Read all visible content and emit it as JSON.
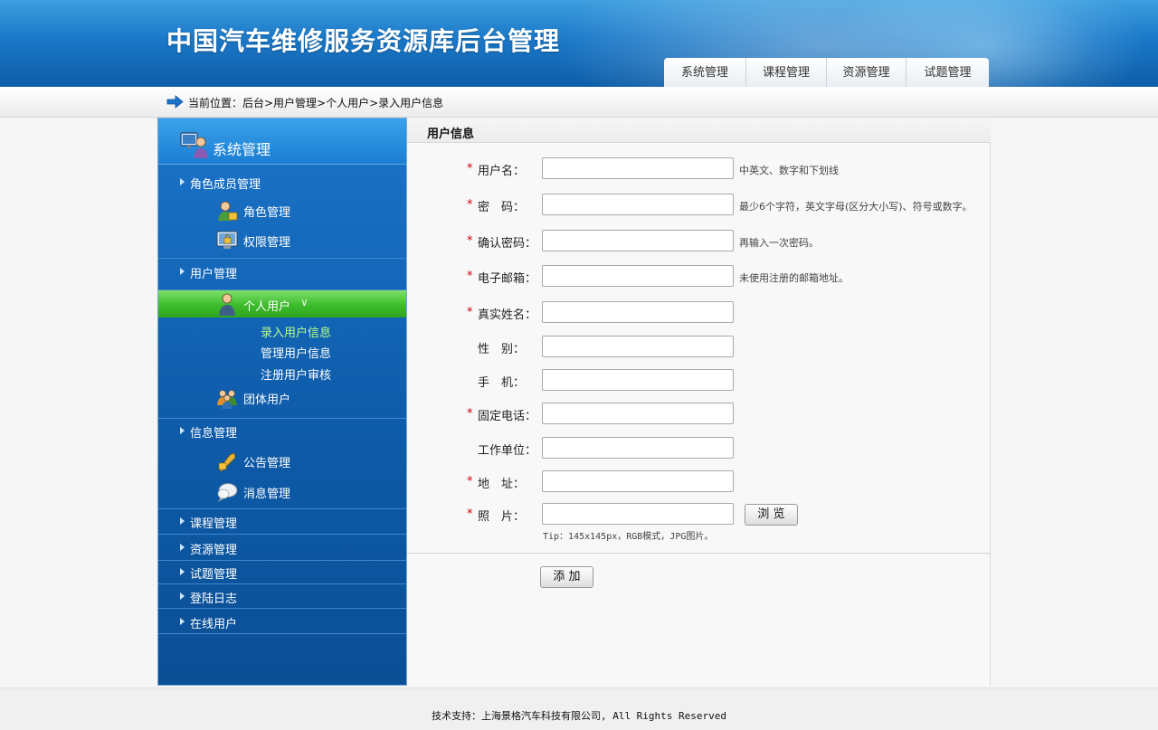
{
  "header": {
    "site_title": "中国汽车维修服务资源库后台管理",
    "nav_tabs": [
      "系统管理",
      "课程管理",
      "资源管理",
      "试题管理"
    ]
  },
  "breadcrumb": {
    "text": "当前位置：后台>用户管理>个人用户>录入用户信息",
    "icon": "arrow-right-icon"
  },
  "sidebar": {
    "title": "系统管理",
    "sections": {
      "role_members": "角色成员管理",
      "role_manage": "角色管理",
      "permission_manage": "权限管理",
      "user_manage": "用户管理",
      "personal_user": "个人用户",
      "personal_sub": [
        "录入用户信息",
        "管理用户信息",
        "注册用户审核"
      ],
      "group_user": "团体用户",
      "info_manage": "信息管理",
      "notice_manage": "公告管理",
      "message_manage": "消息管理",
      "course_manage": "课程管理",
      "resource_manage": "资源管理",
      "exam_manage": "试题管理",
      "login_log": "登陆日志",
      "online_users": "在线用户"
    },
    "active_color": "#3cbc2c",
    "current_sub_color": "#b6ff8a"
  },
  "form": {
    "section_title": "用户信息",
    "fields": [
      {
        "label": "用户名：",
        "required": true,
        "value": "",
        "hint": "中英文、数字和下划线"
      },
      {
        "label": "密　码：",
        "required": true,
        "value": "",
        "hint": "最少6个字符，英文字母(区分大小写)、符号或数字。"
      },
      {
        "label": "确认密码：",
        "required": true,
        "value": "",
        "hint": "再输入一次密码。"
      },
      {
        "label": "电子邮箱：",
        "required": true,
        "value": "",
        "hint": "未使用注册的邮箱地址。"
      },
      {
        "label": "真实姓名：",
        "required": true,
        "value": "",
        "hint": ""
      },
      {
        "label": "性　别：",
        "required": false,
        "value": "",
        "hint": ""
      },
      {
        "label": "手　机：",
        "required": false,
        "value": "",
        "hint": ""
      },
      {
        "label": "固定电话：",
        "required": true,
        "value": "",
        "hint": ""
      },
      {
        "label": "工作单位：",
        "required": false,
        "value": "",
        "hint": ""
      },
      {
        "label": "地　址：",
        "required": true,
        "value": "",
        "hint": ""
      },
      {
        "label": "照　片：",
        "required": true,
        "value": "",
        "hint": ""
      }
    ],
    "required_mark": "*",
    "browse_label": "浏 览",
    "photo_tip": "Tip：145x145px，RGB模式，JPG图片。",
    "submit_label": "添 加"
  },
  "footer": {
    "text": "技术支持：上海景格汽车科技有限公司, All Rights Reserved"
  }
}
